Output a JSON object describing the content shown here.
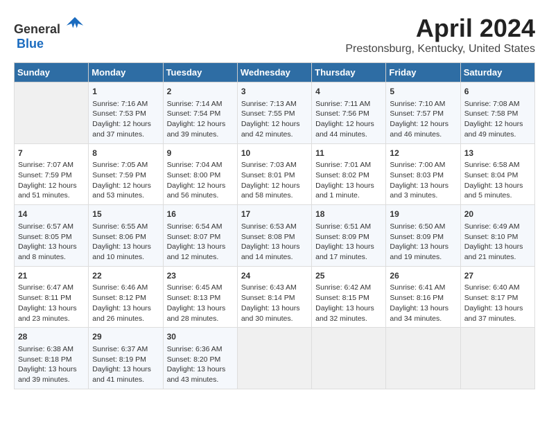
{
  "header": {
    "logo_general": "General",
    "logo_blue": "Blue",
    "title": "April 2024",
    "subtitle": "Prestonsburg, Kentucky, United States"
  },
  "calendar": {
    "days_of_week": [
      "Sunday",
      "Monday",
      "Tuesday",
      "Wednesday",
      "Thursday",
      "Friday",
      "Saturday"
    ],
    "weeks": [
      [
        {
          "day": "",
          "empty": true
        },
        {
          "day": "1",
          "sunrise": "7:16 AM",
          "sunset": "7:53 PM",
          "daylight": "12 hours and 37 minutes."
        },
        {
          "day": "2",
          "sunrise": "7:14 AM",
          "sunset": "7:54 PM",
          "daylight": "12 hours and 39 minutes."
        },
        {
          "day": "3",
          "sunrise": "7:13 AM",
          "sunset": "7:55 PM",
          "daylight": "12 hours and 42 minutes."
        },
        {
          "day": "4",
          "sunrise": "7:11 AM",
          "sunset": "7:56 PM",
          "daylight": "12 hours and 44 minutes."
        },
        {
          "day": "5",
          "sunrise": "7:10 AM",
          "sunset": "7:57 PM",
          "daylight": "12 hours and 46 minutes."
        },
        {
          "day": "6",
          "sunrise": "7:08 AM",
          "sunset": "7:58 PM",
          "daylight": "12 hours and 49 minutes."
        }
      ],
      [
        {
          "day": "7",
          "sunrise": "7:07 AM",
          "sunset": "7:59 PM",
          "daylight": "12 hours and 51 minutes."
        },
        {
          "day": "8",
          "sunrise": "7:05 AM",
          "sunset": "7:59 PM",
          "daylight": "12 hours and 53 minutes."
        },
        {
          "day": "9",
          "sunrise": "7:04 AM",
          "sunset": "8:00 PM",
          "daylight": "12 hours and 56 minutes."
        },
        {
          "day": "10",
          "sunrise": "7:03 AM",
          "sunset": "8:01 PM",
          "daylight": "12 hours and 58 minutes."
        },
        {
          "day": "11",
          "sunrise": "7:01 AM",
          "sunset": "8:02 PM",
          "daylight": "13 hours and 1 minute."
        },
        {
          "day": "12",
          "sunrise": "7:00 AM",
          "sunset": "8:03 PM",
          "daylight": "13 hours and 3 minutes."
        },
        {
          "day": "13",
          "sunrise": "6:58 AM",
          "sunset": "8:04 PM",
          "daylight": "13 hours and 5 minutes."
        }
      ],
      [
        {
          "day": "14",
          "sunrise": "6:57 AM",
          "sunset": "8:05 PM",
          "daylight": "13 hours and 8 minutes."
        },
        {
          "day": "15",
          "sunrise": "6:55 AM",
          "sunset": "8:06 PM",
          "daylight": "13 hours and 10 minutes."
        },
        {
          "day": "16",
          "sunrise": "6:54 AM",
          "sunset": "8:07 PM",
          "daylight": "13 hours and 12 minutes."
        },
        {
          "day": "17",
          "sunrise": "6:53 AM",
          "sunset": "8:08 PM",
          "daylight": "13 hours and 14 minutes."
        },
        {
          "day": "18",
          "sunrise": "6:51 AM",
          "sunset": "8:09 PM",
          "daylight": "13 hours and 17 minutes."
        },
        {
          "day": "19",
          "sunrise": "6:50 AM",
          "sunset": "8:09 PM",
          "daylight": "13 hours and 19 minutes."
        },
        {
          "day": "20",
          "sunrise": "6:49 AM",
          "sunset": "8:10 PM",
          "daylight": "13 hours and 21 minutes."
        }
      ],
      [
        {
          "day": "21",
          "sunrise": "6:47 AM",
          "sunset": "8:11 PM",
          "daylight": "13 hours and 23 minutes."
        },
        {
          "day": "22",
          "sunrise": "6:46 AM",
          "sunset": "8:12 PM",
          "daylight": "13 hours and 26 minutes."
        },
        {
          "day": "23",
          "sunrise": "6:45 AM",
          "sunset": "8:13 PM",
          "daylight": "13 hours and 28 minutes."
        },
        {
          "day": "24",
          "sunrise": "6:43 AM",
          "sunset": "8:14 PM",
          "daylight": "13 hours and 30 minutes."
        },
        {
          "day": "25",
          "sunrise": "6:42 AM",
          "sunset": "8:15 PM",
          "daylight": "13 hours and 32 minutes."
        },
        {
          "day": "26",
          "sunrise": "6:41 AM",
          "sunset": "8:16 PM",
          "daylight": "13 hours and 34 minutes."
        },
        {
          "day": "27",
          "sunrise": "6:40 AM",
          "sunset": "8:17 PM",
          "daylight": "13 hours and 37 minutes."
        }
      ],
      [
        {
          "day": "28",
          "sunrise": "6:38 AM",
          "sunset": "8:18 PM",
          "daylight": "13 hours and 39 minutes."
        },
        {
          "day": "29",
          "sunrise": "6:37 AM",
          "sunset": "8:19 PM",
          "daylight": "13 hours and 41 minutes."
        },
        {
          "day": "30",
          "sunrise": "6:36 AM",
          "sunset": "8:20 PM",
          "daylight": "13 hours and 43 minutes."
        },
        {
          "day": "",
          "empty": true
        },
        {
          "day": "",
          "empty": true
        },
        {
          "day": "",
          "empty": true
        },
        {
          "day": "",
          "empty": true
        }
      ]
    ],
    "labels": {
      "sunrise": "Sunrise:",
      "sunset": "Sunset:",
      "daylight": "Daylight:"
    }
  }
}
